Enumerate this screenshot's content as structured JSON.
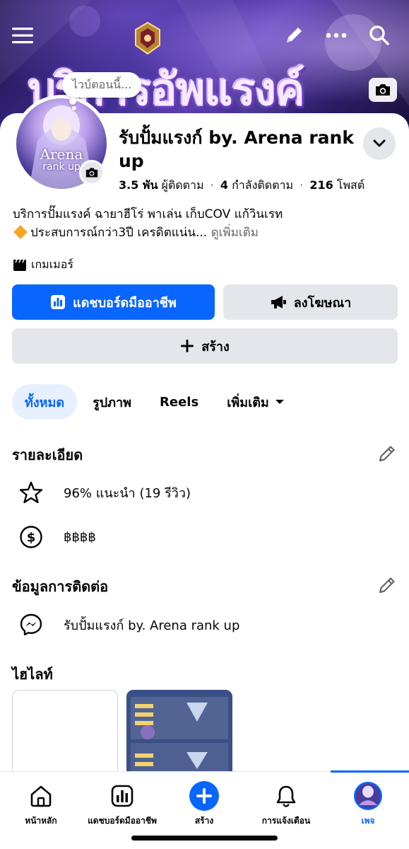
{
  "cover": {
    "title_art": "บริการอัพแรงค์",
    "icons": [
      "menu-icon",
      "pencil-icon",
      "more-icon",
      "search-icon",
      "camera-icon"
    ]
  },
  "profile": {
    "bubble_text": "ไวบ์ตอนนี้...",
    "avatar_text": "Arena",
    "avatar_subtext": "rank up",
    "name": "รับปั้มแรงก์ by. Arena rank up",
    "followers_count": "3.5 พัน",
    "followers_label": "ผู้ติดตาม",
    "following_count": "4",
    "following_label": "กำลังติดตาม",
    "posts_count": "216",
    "posts_label": "โพสต์",
    "bio_line1": "บริการปั๊มแรงค์ ฉายาฮีโร่ พาเล่น เก็บCOV แก้วินเรท",
    "bio_line2": "ประสบการณ์กว่า3ปี เครดิตแน่น...",
    "bio_more": "ดูเพิ่มเติม",
    "category": "เกมเมอร์"
  },
  "actions": {
    "dashboard": "แดชบอร์ดมืออาชีพ",
    "advertise": "ลงโฆษณา",
    "create": "สร้าง"
  },
  "tabs": [
    {
      "label": "ทั้งหมด",
      "active": true
    },
    {
      "label": "รูปภาพ",
      "active": false
    },
    {
      "label": "Reels",
      "active": false
    },
    {
      "label": "เพิ่มเติม",
      "active": false
    }
  ],
  "details": {
    "title": "รายละเอียด",
    "rating": "96% แนะนำ (19 รีวิว)",
    "price": "฿฿฿฿"
  },
  "contact": {
    "title": "ข้อมูลการติดต่อ",
    "messenger": "รับปั้มแรงก์ by. Arena rank up"
  },
  "highlights": {
    "title": "ไฮไลท์"
  },
  "nav": [
    {
      "label": "หน้าหลัก",
      "icon": "home-icon"
    },
    {
      "label": "แดชบอร์ดมืออาชีพ",
      "icon": "dashboard-icon"
    },
    {
      "label": "สร้าง",
      "icon": "plus-icon"
    },
    {
      "label": "การแจ้งเตือน",
      "icon": "bell-icon"
    },
    {
      "label": "เพจ",
      "icon": "page-avatar-icon",
      "active": true
    }
  ],
  "colors": {
    "accent": "#0866ff",
    "button_gray": "#e4e6eb",
    "tab_active_bg": "#e7f0fe",
    "muted_text": "#65676b"
  }
}
